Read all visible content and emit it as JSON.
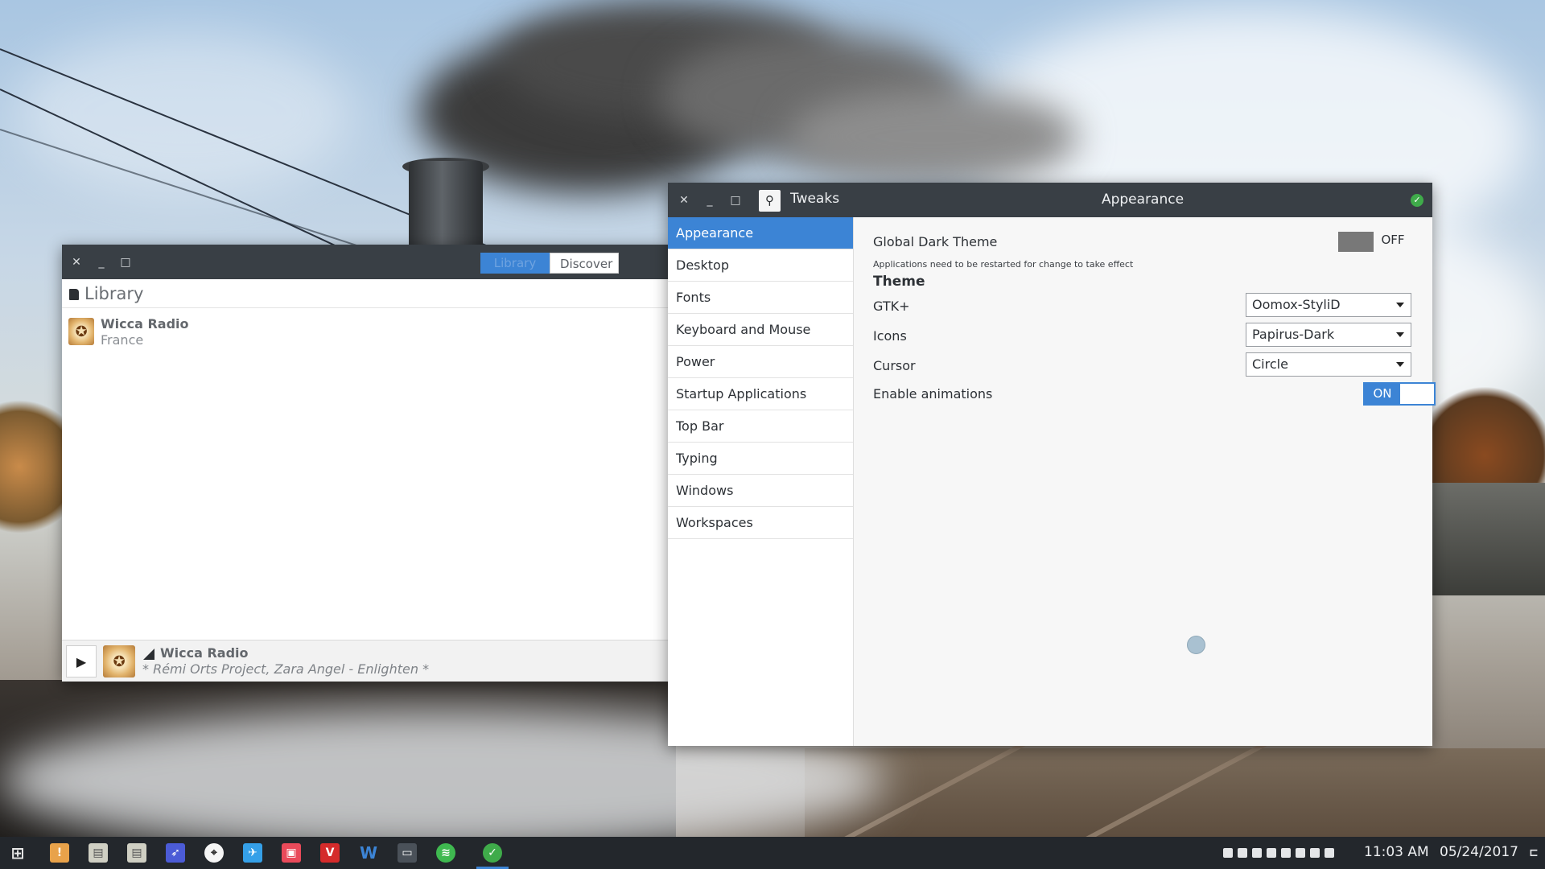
{
  "radio_window": {
    "tabs": {
      "library": "Library",
      "discover": "Discover"
    },
    "header_title": "Library",
    "station": {
      "name": "Wicca Radio",
      "country": "France"
    },
    "now_playing": {
      "station": "Wicca Radio",
      "track": "* Rémi Orts Project, Zara Angel - Enlighten *"
    }
  },
  "tweaks_window": {
    "app_title": "Tweaks",
    "page_title": "Appearance",
    "sidebar": [
      "Appearance",
      "Desktop",
      "Fonts",
      "Keyboard and Mouse",
      "Power",
      "Startup Applications",
      "Top Bar",
      "Typing",
      "Windows",
      "Workspaces"
    ],
    "selected_item": "Appearance",
    "global_dark_theme": {
      "label": "Global Dark Theme",
      "hint": "Applications need to be restarted for change to take effect",
      "state": "OFF"
    },
    "theme_section": "Theme",
    "gtk": {
      "label": "GTK+",
      "value": "Oomox-StyliD"
    },
    "icons": {
      "label": "Icons",
      "value": "Papirus-Dark"
    },
    "cursor": {
      "label": "Cursor",
      "value": "Circle"
    },
    "animations": {
      "label": "Enable animations",
      "state": "ON"
    }
  },
  "taskbar": {
    "time": "11:03 AM",
    "date": "05/24/2017"
  },
  "colors": {
    "accent": "#3c84d5",
    "titlebar": "#393f45",
    "taskbar": "#23272c"
  }
}
